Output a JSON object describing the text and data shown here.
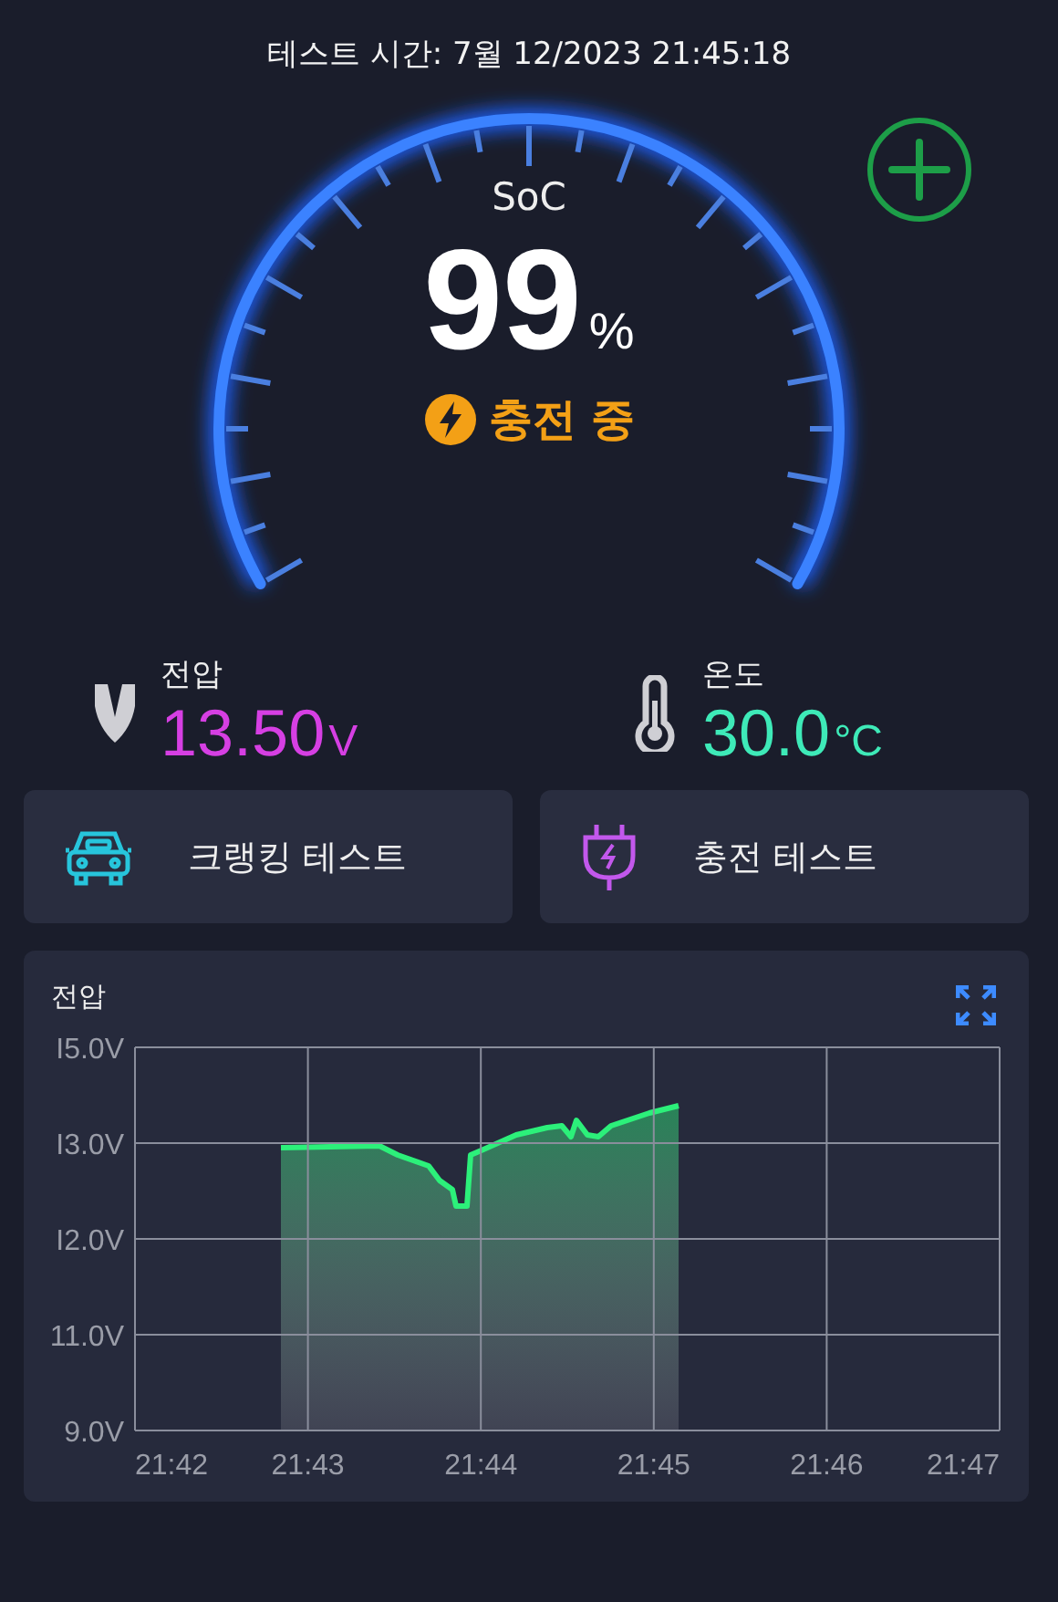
{
  "header": {
    "test_time": "테스트 시간: 7월 12/2023 21:45:18"
  },
  "gauge": {
    "label": "SoC",
    "value": "99",
    "unit": "%",
    "status": "충전 중",
    "charging": true
  },
  "stats": [
    {
      "kind": "voltage",
      "label": "전압",
      "value": "13.50",
      "unit": "V",
      "color": "#d63fe3"
    },
    {
      "kind": "temperature",
      "label": "온도",
      "value": "30.0",
      "unit": "°C",
      "color": "#3eeab8"
    }
  ],
  "actions": [
    {
      "kind": "car",
      "label": "크랭킹 테스트"
    },
    {
      "kind": "plug",
      "label": "충전 테스트"
    }
  ],
  "chart_card": {
    "title": "전압",
    "y_labels": [
      "I5.0V",
      "I3.0V",
      "I2.0V",
      "11.0V",
      "9.0V"
    ],
    "x_labels": [
      "21:42",
      "21:43",
      "21:44",
      "21:45",
      "21:46",
      "21:47"
    ]
  }
}
